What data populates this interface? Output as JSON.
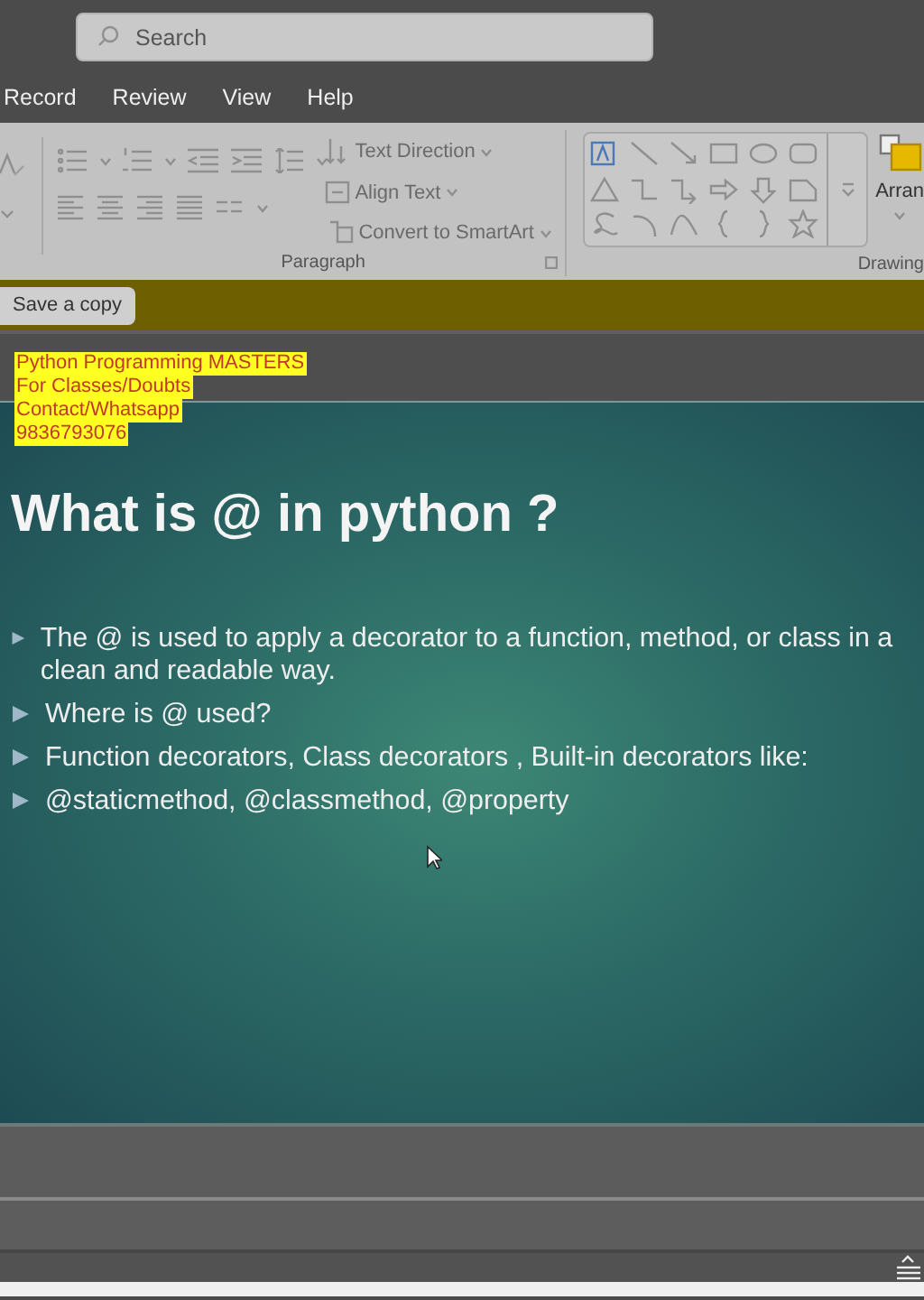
{
  "search": {
    "placeholder": "Search"
  },
  "menu_tabs": [
    {
      "label": "Record"
    },
    {
      "label": "Review"
    },
    {
      "label": "View"
    },
    {
      "label": "Help"
    }
  ],
  "ribbon": {
    "paragraph_commands": [
      "Text Direction",
      "Align Text",
      "Convert to SmartArt"
    ],
    "paragraph_label": "Paragraph",
    "arrange_label": "Arran",
    "drawing_label": "Drawing"
  },
  "message_bar": {
    "button": "Save a copy"
  },
  "overlay_lines": [
    "Python Programming MASTERS",
    "For Classes/Doubts",
    "Contact/Whatsapp",
    "9836793076"
  ],
  "slide": {
    "title": "What is @ in python ?",
    "bullets": [
      "The @ is used to apply a decorator to a function, method, or class in a clean and readable way.",
      "Where is @ used?",
      "Function decorators, Class decorators , Built-in decorators like:",
      "@staticmethod, @classmethod, @property"
    ]
  }
}
